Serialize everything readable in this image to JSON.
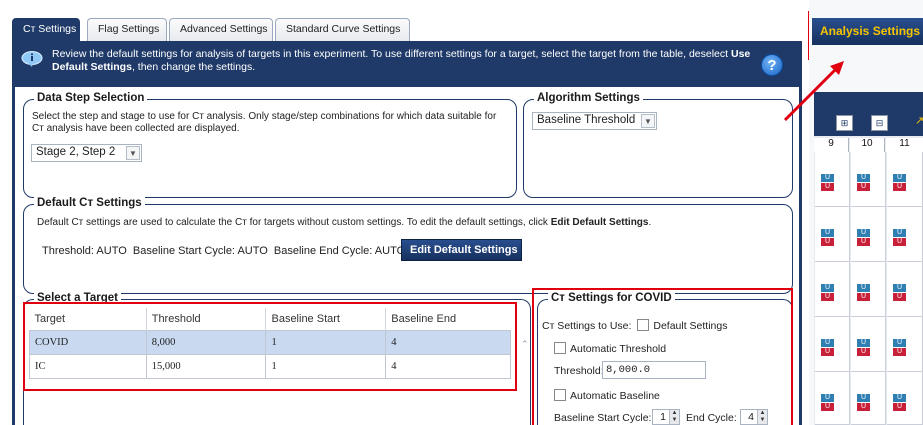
{
  "tabs": [
    {
      "label": "Cт Settings",
      "active": true
    },
    {
      "label": "Flag Settings",
      "active": false
    },
    {
      "label": "Advanced Settings",
      "active": false
    },
    {
      "label": "Standard Curve Settings",
      "active": false
    }
  ],
  "banner": {
    "text_before": "Review the default settings for analysis of targets in this experiment. To use different settings for a target, select the target from the table, deselect ",
    "text_bold": "Use Default Settings",
    "text_after": ", then change the settings.",
    "help_label": "?"
  },
  "data_step": {
    "title": "Data Step Selection",
    "description": "Select the step and stage to use for Cт analysis. Only stage/step combinations for which data suitable for Cт analysis have been collected are displayed.",
    "selected": "Stage 2, Step 2"
  },
  "algorithm": {
    "title": "Algorithm Settings",
    "selected": "Baseline Threshold"
  },
  "default_ct": {
    "title": "Default Cт Settings",
    "description_before": "Default Cт settings are used to calculate the Cт for targets without custom settings. To edit the default settings, click ",
    "description_bold": "Edit Default Settings",
    "description_after": ".",
    "summary": "Threshold: AUTO  Baseline Start Cycle: AUTO  Baseline End Cycle: AUTO",
    "edit_button": "Edit Default Settings"
  },
  "target_table": {
    "title": "Select a Target",
    "columns": [
      "Target",
      "Threshold",
      "Baseline Start",
      "Baseline End"
    ],
    "rows": [
      {
        "target": "COVID",
        "threshold": "8,000",
        "baseline_start": "1",
        "baseline_end": "4",
        "selected": true
      },
      {
        "target": "IC",
        "threshold": "15,000",
        "baseline_start": "1",
        "baseline_end": "4",
        "selected": false
      }
    ]
  },
  "ct_covid": {
    "title": "Cт Settings for COVID",
    "settings_to_use_label": "Cт Settings to Use:",
    "default_settings_label": "Default Settings",
    "auto_threshold_label": "Automatic Threshold",
    "threshold_label": "Threshold:",
    "threshold_value": "8,000.0",
    "auto_baseline_label": "Automatic Baseline",
    "baseline_start_label": "Baseline Start Cycle:",
    "baseline_start_value": "1",
    "end_cycle_label": "End Cycle:",
    "end_cycle_value": "4"
  },
  "plate": {
    "analysis_button": "Analysis Settings",
    "columns": [
      "9",
      "10",
      "11"
    ],
    "well_label": "U"
  },
  "colors": {
    "navy": "#1f3a68",
    "highlight_red": "#e00010",
    "analysis_text": "#f5c400",
    "selected_row": "#c8d9f0"
  }
}
